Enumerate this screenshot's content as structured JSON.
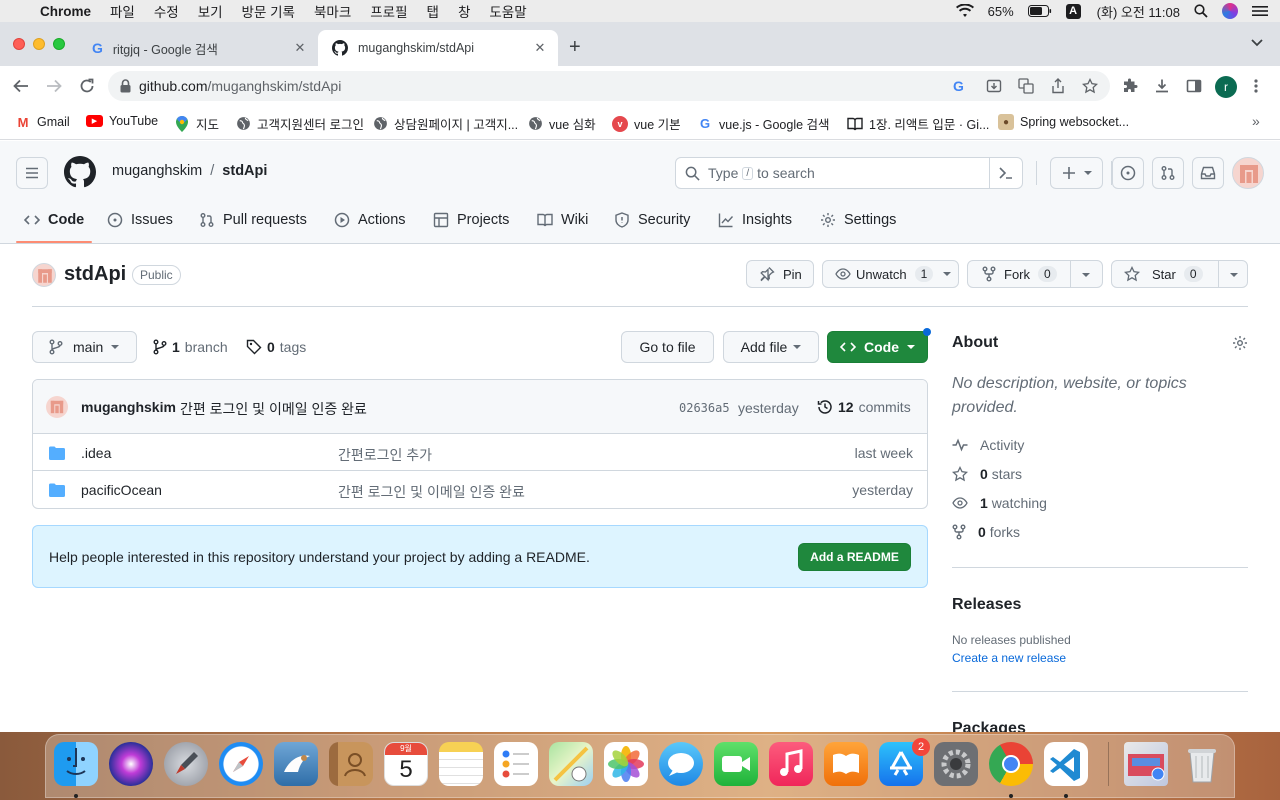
{
  "menubar": {
    "app": "Chrome",
    "items": [
      "파일",
      "수정",
      "보기",
      "방문 기록",
      "북마크",
      "프로필",
      "탭",
      "창",
      "도움말"
    ],
    "battery": "65%",
    "input_source": "A",
    "clock": "(화) 오전 11:08"
  },
  "tabs": [
    {
      "title": "ritgjq - Google 검색",
      "icon": "google-icon"
    },
    {
      "title": "muganghskim/stdApi",
      "icon": "github-icon"
    }
  ],
  "omnibox": {
    "host": "github.com",
    "path": "/muganghskim/stdApi"
  },
  "profile_initial": "r",
  "bookmarks": [
    {
      "label": "Gmail",
      "icon": "gmail-icon"
    },
    {
      "label": "YouTube",
      "icon": "youtube-icon"
    },
    {
      "label": "지도",
      "icon": "maps-pin-icon"
    },
    {
      "label": "고객지원센터 로그인",
      "icon": "globe-icon"
    },
    {
      "label": "상담원페이지 | 고객지...",
      "icon": "globe-icon"
    },
    {
      "label": "vue 심화",
      "icon": "globe-icon"
    },
    {
      "label": "vue 기본",
      "icon": "vue-icon"
    },
    {
      "label": "vue.js - Google 검색",
      "icon": "google-icon"
    },
    {
      "label": "1장. 리액트 입문 · Gi...",
      "icon": "book-icon"
    },
    {
      "label": "Spring websocket...",
      "icon": "dog-icon"
    }
  ],
  "github": {
    "owner": "muganghskim",
    "slash": "/",
    "repo": "stdApi",
    "search_placeholder_pre": "Type",
    "search_key": "/",
    "search_placeholder_post": "to search",
    "nav": [
      "Code",
      "Issues",
      "Pull requests",
      "Actions",
      "Projects",
      "Wiki",
      "Security",
      "Insights",
      "Settings"
    ],
    "visibility": "Public",
    "pin": "Pin",
    "unwatch": "Unwatch",
    "watch_count": "1",
    "fork": "Fork",
    "fork_count": "0",
    "star": "Star",
    "star_count": "0"
  },
  "branchbar": {
    "branch": "main",
    "branch_count": "1",
    "branch_label": "branch",
    "tag_count": "0",
    "tag_label": "tags",
    "go_to_file": "Go to file",
    "add_file": "Add file",
    "code": "Code"
  },
  "commit": {
    "author": "muganghskim",
    "message": "간편 로그인 및 이메일 인증 완료",
    "sha": "02636a5",
    "when": "yesterday",
    "count": "12",
    "count_label": "commits"
  },
  "files": [
    {
      "name": ".idea",
      "message": "간편로그인 추가",
      "age": "last week"
    },
    {
      "name": "pacificOcean",
      "message": "간편 로그인 및 이메일 인증 완료",
      "age": "yesterday"
    }
  ],
  "readme": {
    "text": "Help people interested in this repository understand your project by adding a README.",
    "button": "Add a README"
  },
  "about": {
    "title": "About",
    "description": "No description, website, or topics provided.",
    "activity": "Activity",
    "stars_count": "0",
    "stars_label": "stars",
    "watching_count": "1",
    "watching_label": "watching",
    "forks_count": "0",
    "forks_label": "forks"
  },
  "releases": {
    "title": "Releases",
    "none": "No releases published",
    "create": "Create a new release"
  },
  "packages": {
    "title": "Packages"
  },
  "dock": {
    "calendar_month": "9월",
    "calendar_day": "5",
    "appstore_badge": "2",
    "apps": [
      "finder-icon",
      "siri-icon",
      "launchpad-icon",
      "safari-icon",
      "mail-icon",
      "contacts-icon",
      "calendar-icon",
      "notes-icon",
      "reminders-icon",
      "maps-icon",
      "photos-icon",
      "messages-icon",
      "facetime-icon",
      "music-icon",
      "books-icon",
      "appstore-icon",
      "system-preferences-icon",
      "chrome-icon",
      "vscode-icon",
      "downloads-icon",
      "trash-icon"
    ]
  },
  "colors": {
    "green": "#1f883d",
    "link": "#0969da",
    "nav_underline": "#fd8c73",
    "readme_bg": "#ddf4ff"
  }
}
